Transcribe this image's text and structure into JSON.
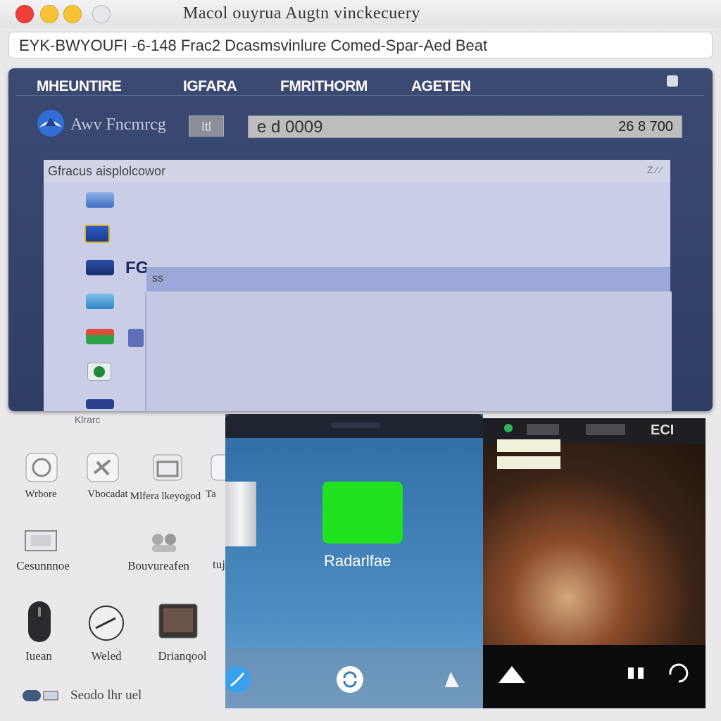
{
  "window": {
    "title": "Macol ouyrua Augtn vinckecuery",
    "address": "EYK-BWYOUFI -6-148 Frac2 Dcasmsvinlure Comed-Spar-Aed Beat"
  },
  "menu": {
    "items": [
      "MHEUNTIRE",
      "IGFARA",
      "FMRITHORM",
      "AGETEN"
    ]
  },
  "toolbar": {
    "app_name": "Awv Fncmrcg",
    "small_button": "Itl",
    "field_left": "e d 0009",
    "field_right": "26 8 700"
  },
  "panel": {
    "title": "Gfracus aisplolcowor",
    "corner": "Z ∕ ∕",
    "selected_row": "ss",
    "row_prefix": "FG",
    "footer": "Klrarc"
  },
  "desktop": {
    "icons": [
      {
        "label": "Wrbore",
        "icon": "globe-icon"
      },
      {
        "label": "Vbocadat",
        "icon": "tools-icon"
      },
      {
        "label": "Mlfera lkeyogod",
        "icon": "box-icon"
      },
      {
        "label": "Ta",
        "icon": "partial-icon"
      },
      {
        "label": "Cesunnnoe",
        "icon": "monitor-icon"
      },
      {
        "label": "Bouvureafen",
        "icon": "people-icon"
      },
      {
        "label": "tujp",
        "icon": "file-icon"
      },
      {
        "label": "Iuean",
        "icon": "mouse-icon"
      },
      {
        "label": "Weled",
        "icon": "clock-icon"
      },
      {
        "label": "Drianqool",
        "icon": "tv-icon"
      },
      {
        "label": "Seodo lhr uel",
        "icon": "toggle-icon"
      }
    ]
  },
  "phone": {
    "tile_label": "Radarlfae",
    "dock_icons": [
      "safari-icon",
      "sync-icon",
      "bell-icon"
    ]
  },
  "photo": {
    "top_label": "ECI",
    "bottom_icons": [
      "up-arrow-icon",
      "pause-icon",
      "refresh-icon"
    ]
  },
  "colors": {
    "traffic_red": "#ef3f36",
    "traffic_yellow": "#f6c434",
    "traffic_gray": "#d0d0d4",
    "window_navy": "#34436b",
    "panel_lavender": "#c9cde6",
    "selection_blue": "#9ba8d8",
    "green_tile": "#21e21e"
  }
}
